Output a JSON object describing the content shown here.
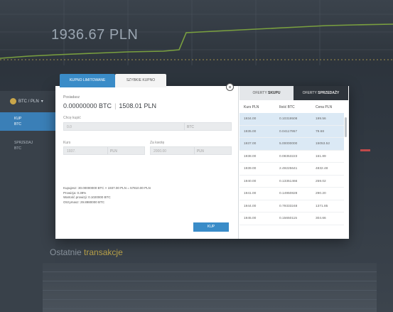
{
  "header": {
    "price": "1936.67 PLN"
  },
  "sidebar": {
    "pair": "BTC / PLN",
    "items": [
      {
        "label": "KUP",
        "sub": "BTC"
      },
      {
        "label": "SPRZEDAJ",
        "sub": "BTC"
      }
    ]
  },
  "modal": {
    "tabs": [
      "KUPNO LIMITOWANE",
      "SZYBKIE KUPNO"
    ],
    "close": "×",
    "available_label": "Posiadasz",
    "available_btc": "0.00000000 BTC",
    "available_pln": "1508.01 PLN",
    "fields": {
      "amount_label": "Chcę kupić",
      "amount_value": "0.0",
      "amount_unit": "BTC",
      "rate_label": "Kurs",
      "rate_value": "1937.",
      "rate_unit": "PLN",
      "total_label": "Za kwotę",
      "total_value": "2000.00",
      "total_unit": "PLN"
    },
    "summary": [
      "Kupujesz: 30.00000000 BTC × 1937.00 PLN = 57810.00 PLN",
      "Prowizja: 0.39%",
      "Wartość prowizji: 0.1020000 BTC",
      "Otrzymasz: 29.8980000 BTC"
    ],
    "buy_button": "KUP"
  },
  "offers": {
    "tab_buy_prefix": "OFERTY",
    "tab_buy_bold": "SKUPU",
    "tab_sell_prefix": "OFERTY",
    "tab_sell_bold": "SPRZEDAŻY",
    "columns": [
      "Kurs PLN",
      "Ilość BTC",
      "Cena PLN"
    ],
    "rows": [
      [
        "1934.00",
        "0.10319508",
        "199.56"
      ],
      [
        "1935.00",
        "0.04117957",
        "79.68"
      ],
      [
        "1937.00",
        "5.00000000",
        "15053.52"
      ],
      [
        "1938.00",
        "0.08353223",
        "161.89"
      ],
      [
        "1939.00",
        "2.49225641",
        "4832.48"
      ],
      [
        "1940.00",
        "0.13351466",
        "259.02"
      ],
      [
        "1941.00",
        "0.14950828",
        "290.20"
      ],
      [
        "1944.00",
        "0.79333248",
        "1371.85"
      ],
      [
        "1945.00",
        "0.15650115",
        "304.66"
      ]
    ]
  },
  "background": {
    "history_title_a": "Ostatnie",
    "history_title_b": "transakcje"
  },
  "colors": {
    "accent": "#3a8cc8",
    "dark": "#2e343b",
    "highlight": "#dbe9f5"
  }
}
